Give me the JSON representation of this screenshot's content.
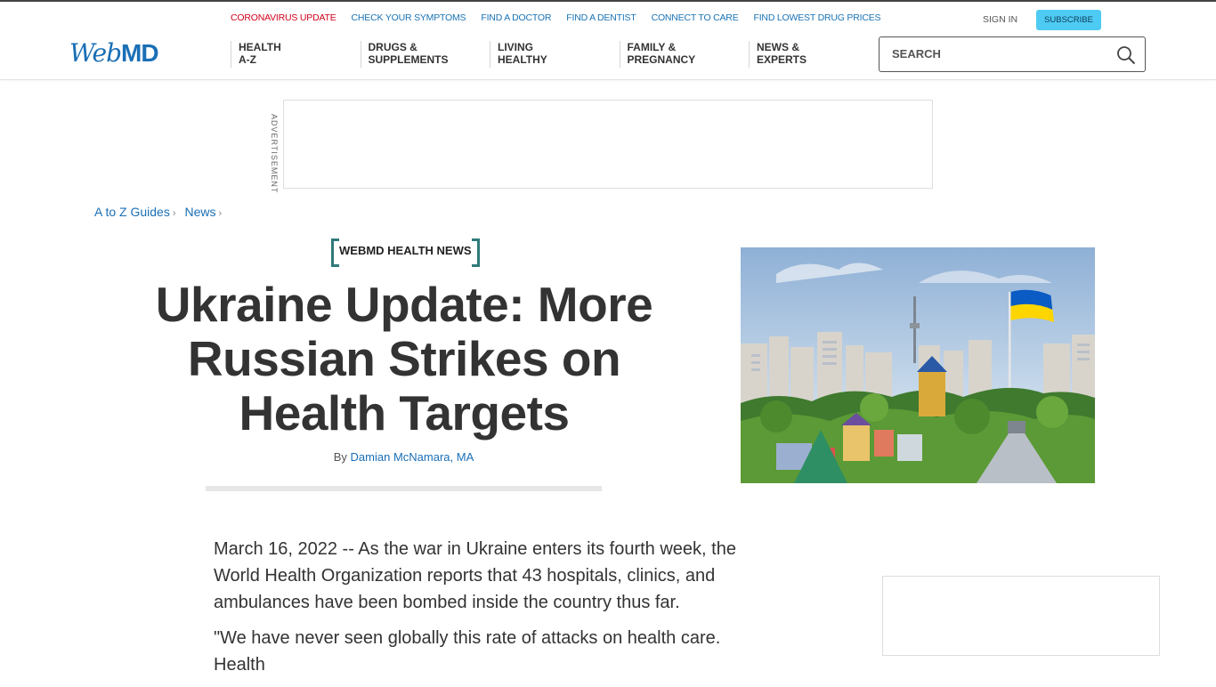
{
  "utility_nav": [
    {
      "label": "CORONAVIRUS UPDATE",
      "color": "#d0021b"
    },
    {
      "label": "CHECK YOUR SYMPTOMS"
    },
    {
      "label": "FIND A DOCTOR"
    },
    {
      "label": "FIND A DENTIST"
    },
    {
      "label": "CONNECT TO CARE"
    },
    {
      "label": "FIND LOWEST DRUG PRICES"
    }
  ],
  "account": {
    "sign_in": "SIGN IN",
    "subscribe": "SUBSCRIBE"
  },
  "logo": {
    "web": "Web",
    "md": "MD"
  },
  "main_nav": [
    {
      "line1": "HEALTH",
      "line2": "A-Z"
    },
    {
      "line1": "DRUGS &",
      "line2": "SUPPLEMENTS"
    },
    {
      "line1": "LIVING",
      "line2": "HEALTHY"
    },
    {
      "line1": "FAMILY &",
      "line2": "PREGNANCY"
    },
    {
      "line1": "NEWS &",
      "line2": "EXPERTS"
    }
  ],
  "search": {
    "placeholder": "SEARCH",
    "icon": "search-icon"
  },
  "ad": {
    "label": "ADVERTISEMENT"
  },
  "breadcrumb": [
    {
      "label": "A to Z Guides"
    },
    {
      "label": "News"
    }
  ],
  "article": {
    "tag": "WEBMD HEALTH NEWS",
    "headline": "Ukraine Update: More Russian Strikes on Health Targets",
    "byline_prefix": "By",
    "author": "Damian McNamara, MA",
    "paragraphs": [
      "March 16, 2022 -- As the war in Ukraine enters its fourth week, the World Health Organization reports that 43 hospitals, clinics, and ambulances have been bombed inside the country thus far.",
      "\"We have never seen globally this rate of attacks on health care. Health"
    ]
  },
  "colors": {
    "brand": "#1a6fb6",
    "accent_red": "#d0021b",
    "subscribe_bg": "#4ecbf3",
    "tag_bracket": "#2f7a7a"
  }
}
